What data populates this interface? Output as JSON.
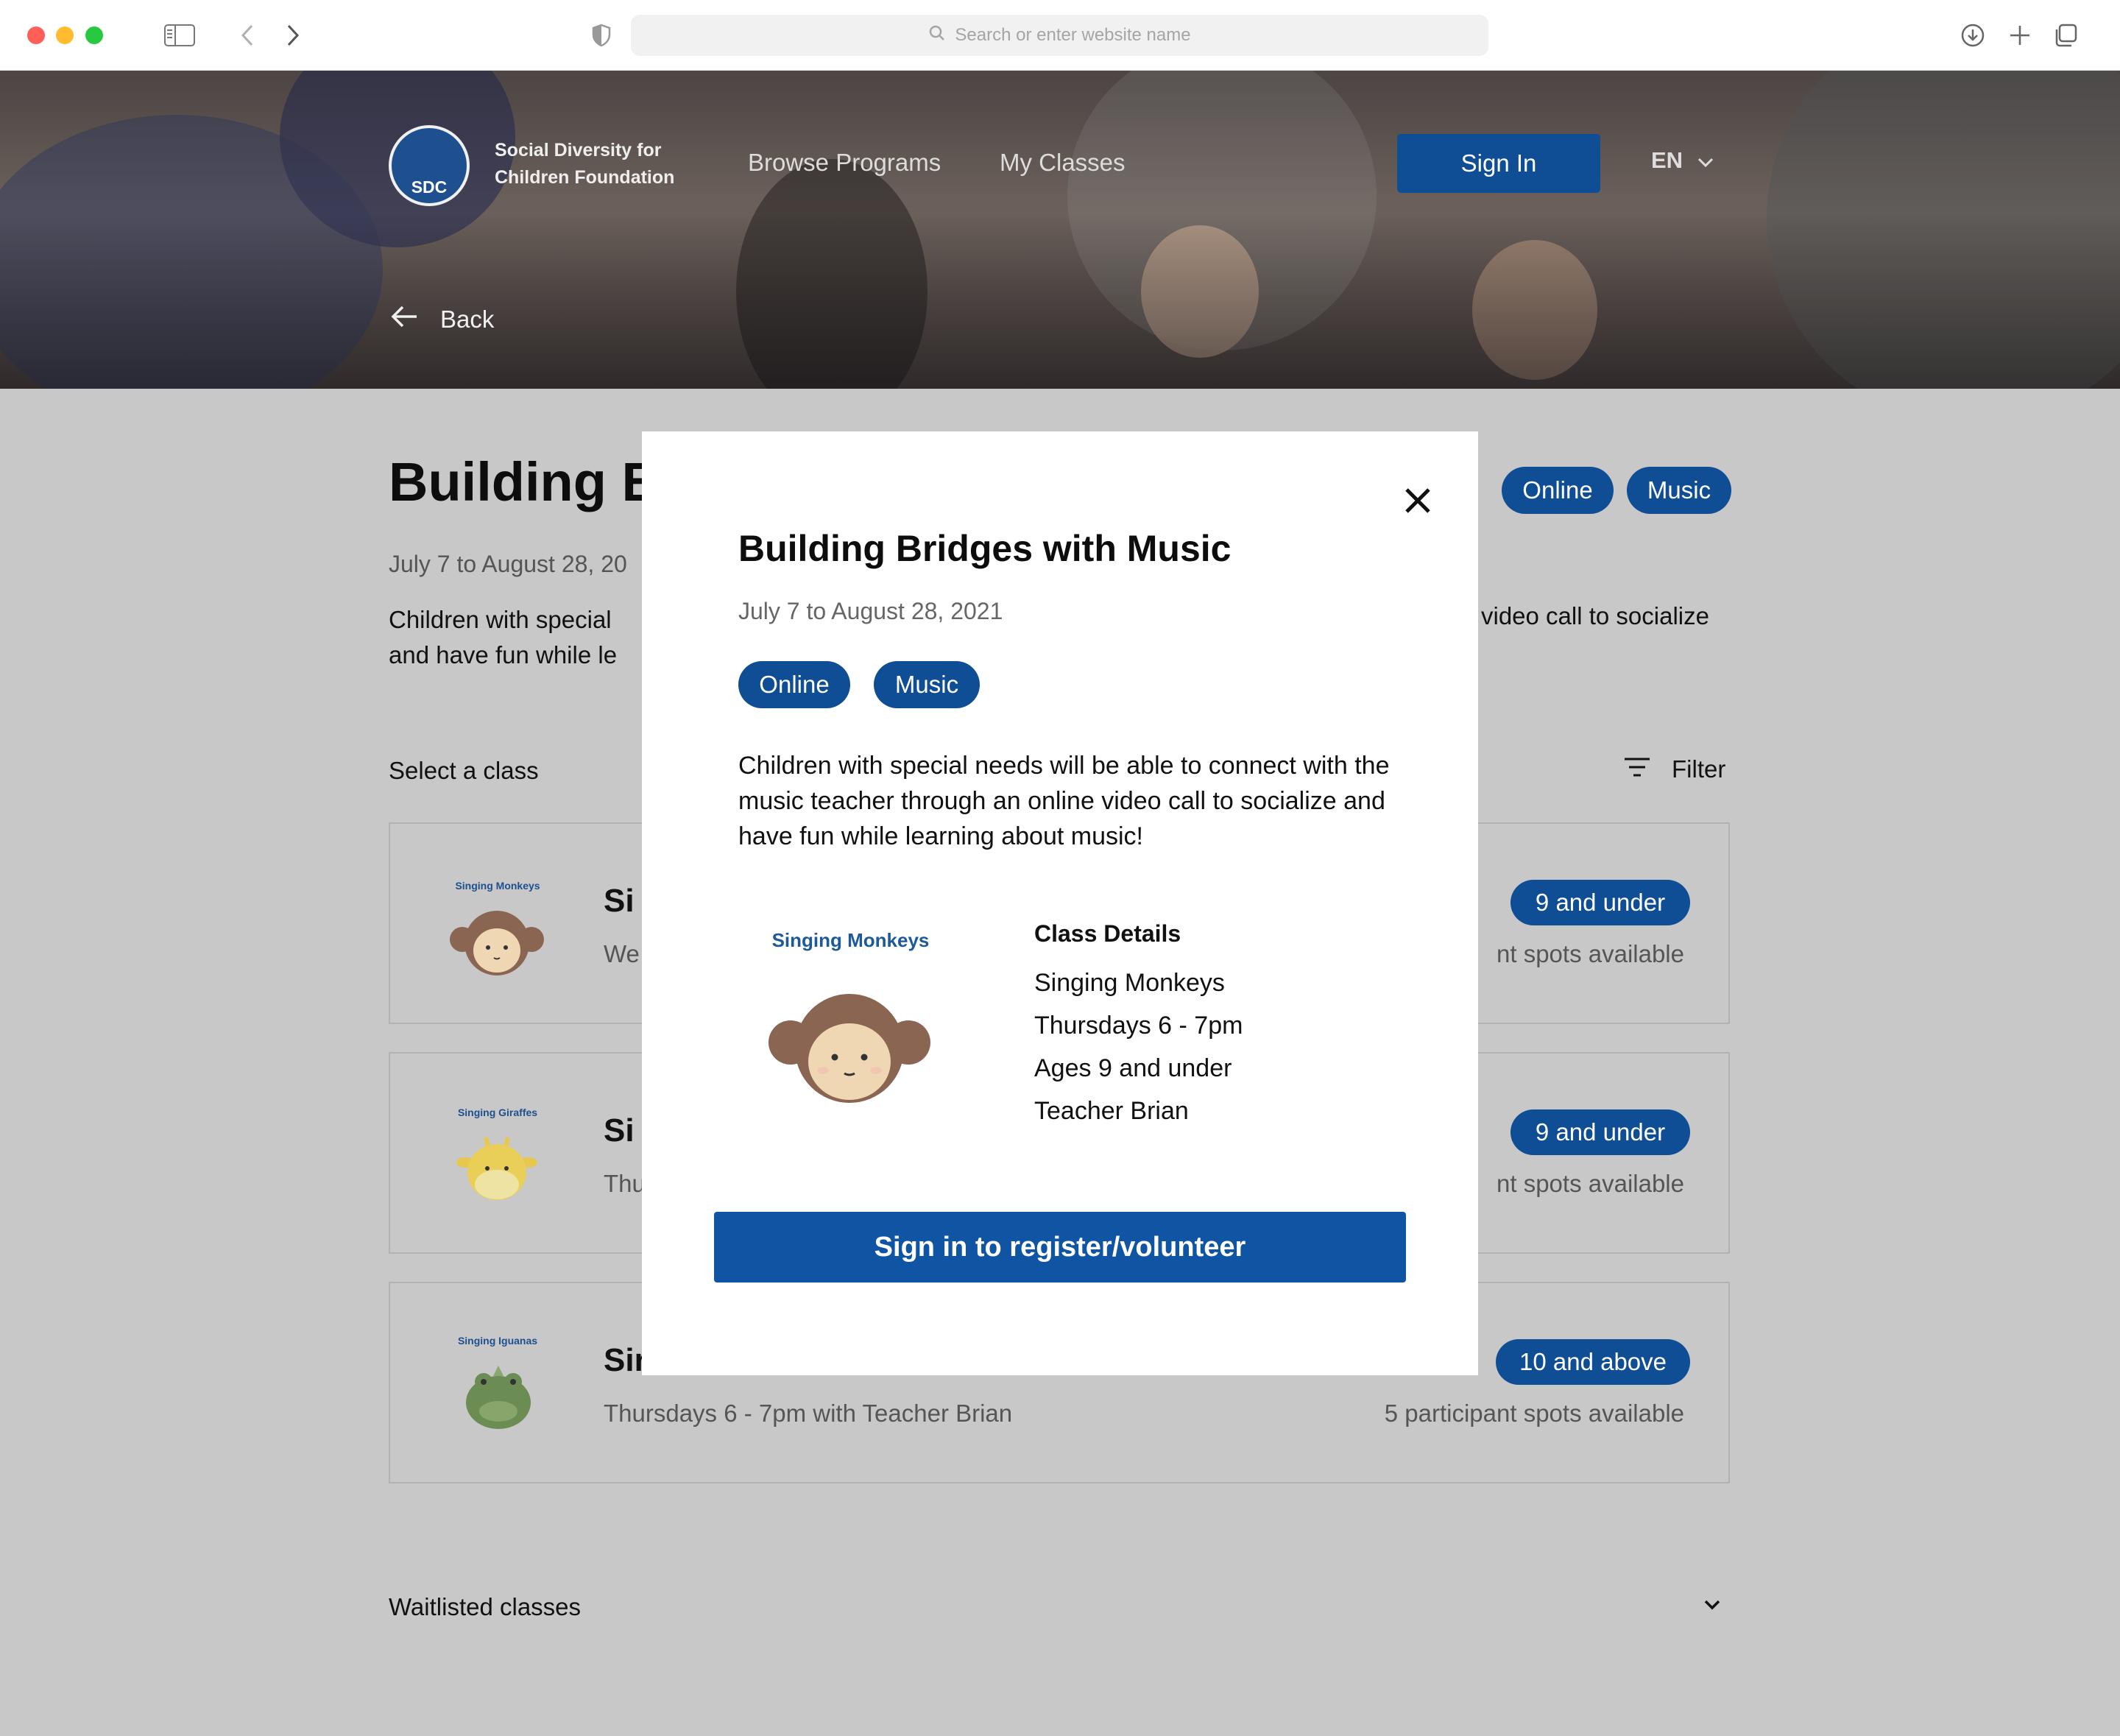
{
  "browser": {
    "url_placeholder": "Search or enter website name"
  },
  "header": {
    "logo_text": "SDC",
    "org_name_line1": "Social Diversity for",
    "org_name_line2": "Children Foundation",
    "nav": [
      "Browse Programs",
      "My Classes"
    ],
    "sign_in": "Sign In",
    "language": "EN",
    "back": "Back"
  },
  "program": {
    "title_visible": "Building B",
    "date_visible": "July 7 to August 28, 20",
    "desc_left_line1": "Children with special",
    "desc_left_line2": "and have fun while le",
    "desc_right_line1": "video call to socialize",
    "tags": [
      "Online",
      "Music"
    ],
    "select_class": "Select a class",
    "filter": "Filter",
    "classes": [
      {
        "thumb_title": "Singing Monkeys",
        "name": "Si",
        "sub": "We",
        "age": "9 and under",
        "spots": "nt spots available"
      },
      {
        "thumb_title": "Singing Giraffes",
        "name": "Si",
        "sub": "Thu",
        "age": "9 and under",
        "spots": "nt spots available"
      },
      {
        "thumb_title": "Singing Iguanas",
        "name": "Sir",
        "sub": "Thursdays 6 - 7pm with Teacher Brian",
        "age": "10 and above",
        "spots": "5 participant spots available"
      }
    ],
    "waitlisted": "Waitlisted classes"
  },
  "modal": {
    "title": "Building Bridges with Music",
    "date": "July 7 to August 28, 2021",
    "tags": [
      "Online",
      "Music"
    ],
    "description": "Children with special needs will be able to connect with the music teacher through an online video call to socialize and have fun while learning about music!",
    "thumb_title": "Singing Monkeys",
    "details_heading": "Class Details",
    "details": [
      "Singing Monkeys",
      "Thursdays 6 - 7pm",
      "Ages 9 and under",
      "Teacher Brian"
    ],
    "cta": "Sign in to register/volunteer"
  },
  "colors": {
    "brand_blue": "#0f4d94",
    "overlay": "#c8c8c8"
  },
  "icons": [
    "sidebar-icon",
    "back-chevron-icon",
    "forward-chevron-icon",
    "shield-icon",
    "search-icon",
    "download-icon",
    "plus-icon",
    "tabs-icon",
    "arrow-left-icon",
    "chevron-down-icon",
    "filter-icon",
    "close-icon"
  ]
}
